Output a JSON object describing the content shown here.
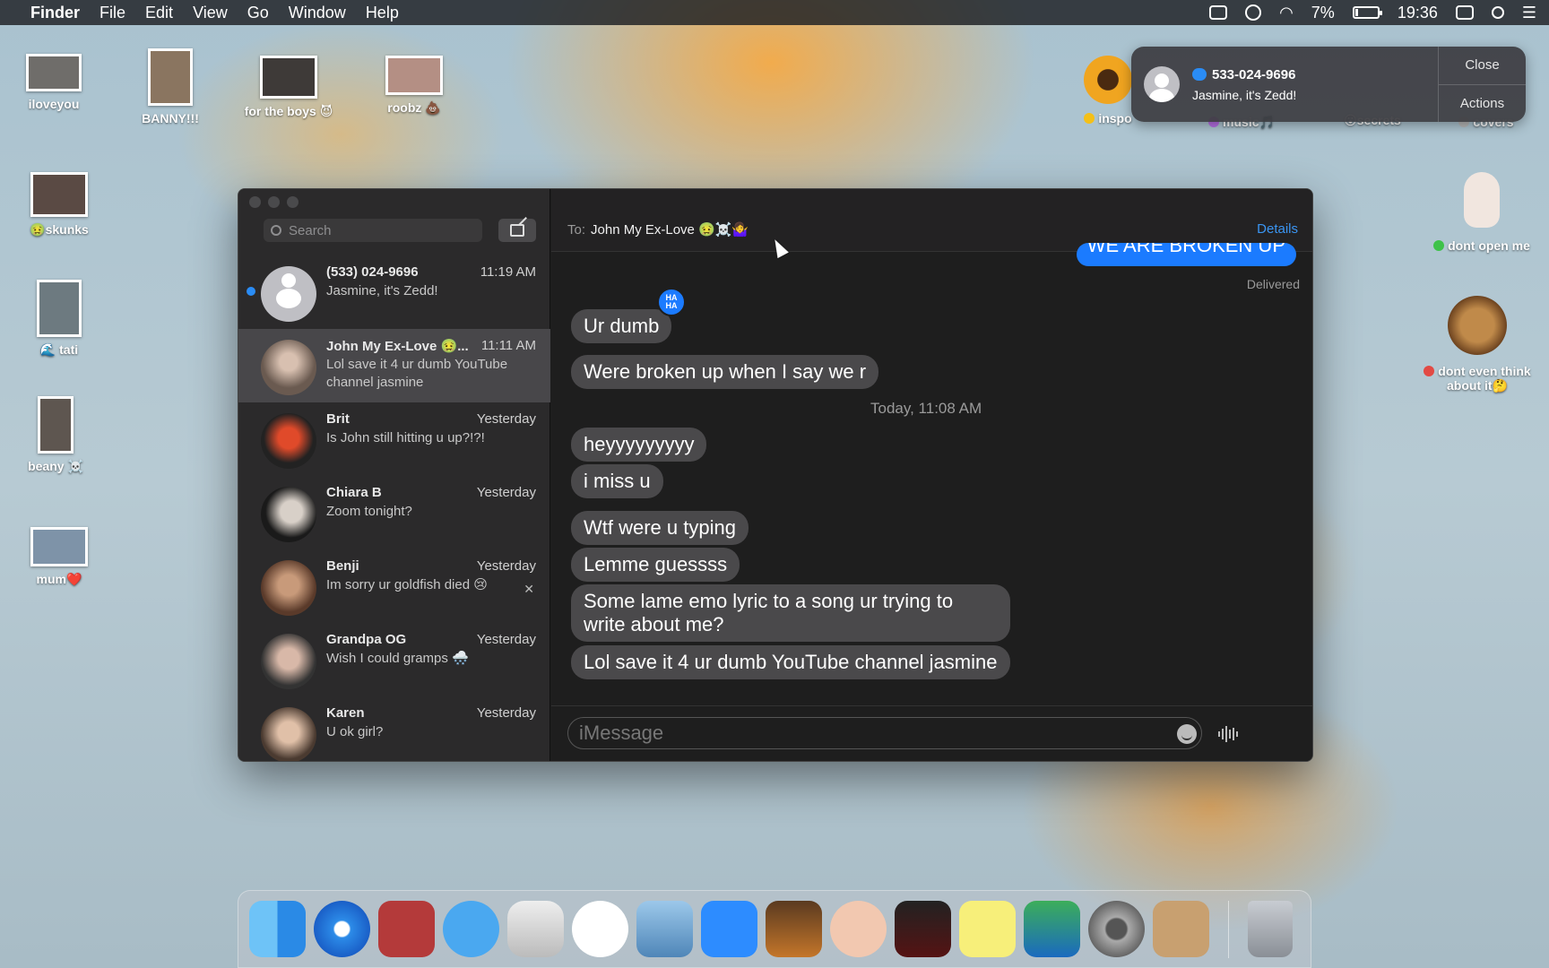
{
  "menubar": {
    "apple": "",
    "items": [
      "Finder",
      "File",
      "Edit",
      "View",
      "Go",
      "Window",
      "Help"
    ],
    "battery": "7%",
    "clock": "19:36"
  },
  "desktop": {
    "left": [
      "iloveyou",
      "BANNY!!!",
      "for the boys 😈",
      "roobz 💩",
      "🤢skunks",
      "🌊 tati",
      "beany ☠️",
      "mum❤️"
    ],
    "right": [
      "inspo",
      "music🎵",
      "😮secrets",
      "covers",
      "dont open me",
      "dont even think about it🤔"
    ]
  },
  "notification": {
    "title": "533-024-9696",
    "body": "Jasmine, it's Zedd!",
    "close": "Close",
    "actions": "Actions"
  },
  "messages": {
    "search_placeholder": "Search",
    "conversations": [
      {
        "name": "(533) 024-9696",
        "time": "11:19 AM",
        "preview": "Jasmine, it's Zedd!"
      },
      {
        "name": "John My Ex-Love 🤢...",
        "time": "11:11 AM",
        "preview": "Lol save it 4 ur dumb YouTube channel jasmine"
      },
      {
        "name": "Brit",
        "time": "Yesterday",
        "preview": "Is John still hitting u up?!?!"
      },
      {
        "name": "Chiara B",
        "time": "Yesterday",
        "preview": "Zoom tonight?"
      },
      {
        "name": "Benji",
        "time": "Yesterday",
        "preview": "Im sorry ur goldfish died 😢"
      },
      {
        "name": "Grandpa OG",
        "time": "Yesterday",
        "preview": "Wish I could gramps 🌨️"
      },
      {
        "name": "Karen",
        "time": "Yesterday",
        "preview": "U ok girl?"
      }
    ],
    "chat": {
      "to_label": "To:",
      "recipient": "John My Ex-Love 🤢☠️🤷‍♀️",
      "details": "Details",
      "sent_top": "WE ARE BROKEN UP",
      "delivered": "Delivered",
      "tapback": "HA HA",
      "timestamp": "Today, 11:08 AM",
      "bubbles": [
        "Ur dumb",
        "Were broken up when I say we r",
        "heyyyyyyyyy",
        "i miss u",
        "Wtf were u typing",
        "Lemme guessss",
        "Some lame emo lyric to a song ur trying to write about me?",
        "Lol save it 4 ur dumb YouTube channel jasmine"
      ],
      "input_placeholder": "iMessage"
    }
  },
  "dock": [
    "Finder",
    "Safari",
    "Photo Booth",
    "Messages",
    "Inkscape",
    "Music",
    "Sequel Pro",
    "Zoom",
    "GarageBand",
    "Memoji",
    "Voice Memos",
    "Stickies",
    "Preview",
    "System Preferences",
    "Contacts",
    "Trash"
  ]
}
